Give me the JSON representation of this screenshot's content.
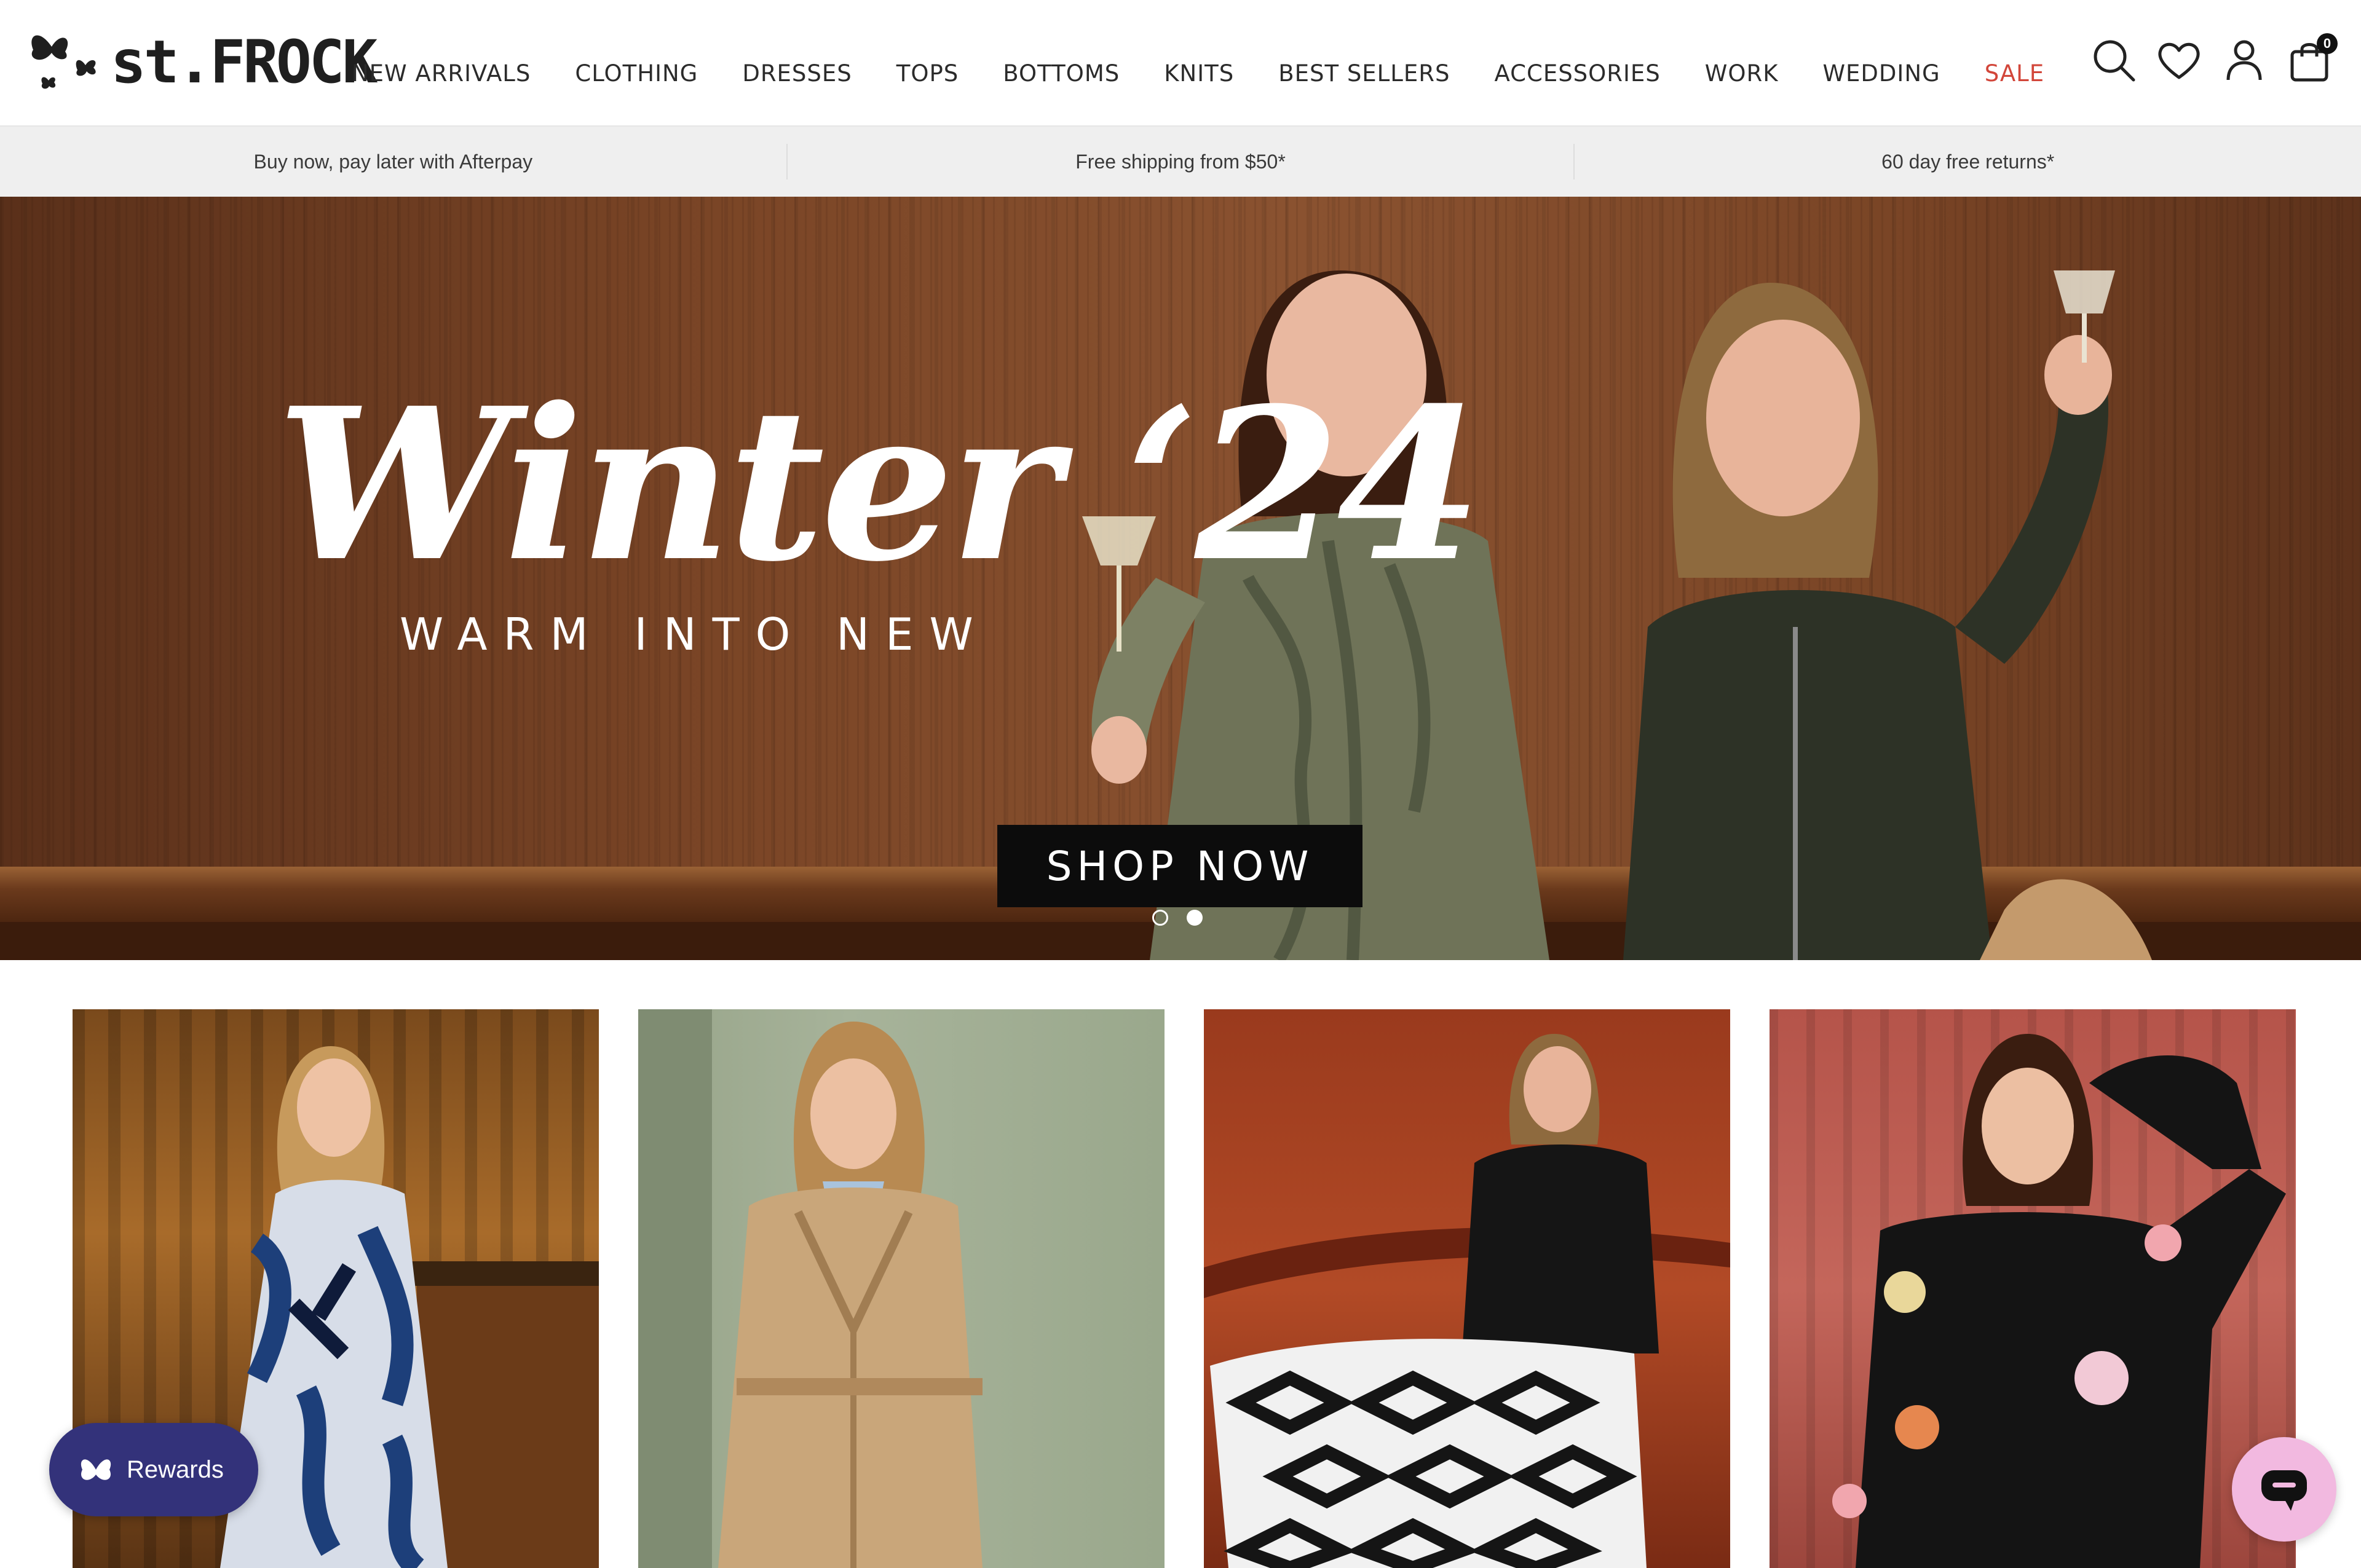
{
  "header": {
    "logo_text": "st.FROCK",
    "nav": [
      {
        "label": "NEW ARRIVALS"
      },
      {
        "label": "CLOTHING"
      },
      {
        "label": "DRESSES"
      },
      {
        "label": "TOPS"
      },
      {
        "label": "BOTTOMS"
      },
      {
        "label": "KNITS"
      },
      {
        "label": "BEST SELLERS"
      },
      {
        "label": "ACCESSORIES"
      },
      {
        "label": "WORK"
      },
      {
        "label": "WEDDING"
      },
      {
        "label": "SALE"
      }
    ],
    "icons": [
      "search-icon",
      "wishlist-heart-icon",
      "account-icon",
      "cart-bag-icon"
    ],
    "cart_count": "0",
    "sale_color": "#d2463a"
  },
  "announcement": {
    "items": [
      {
        "text": "Buy now, pay later with Afterpay"
      },
      {
        "text": "Free shipping from $50*"
      },
      {
        "text": "60 day free returns*"
      }
    ]
  },
  "hero": {
    "title": "Winter ‘24",
    "subtitle": "WARM INTO NEW",
    "cta_label": "SHOP NOW",
    "slides_total": 2,
    "active_slide": 2
  },
  "tiles": [
    {
      "name": "tile-printed-dress"
    },
    {
      "name": "tile-trench-coat"
    },
    {
      "name": "tile-geometric-skirt"
    },
    {
      "name": "tile-floral-cardigan"
    }
  ],
  "widgets": {
    "rewards_label": "Rewards",
    "rewards_color": "#33327a",
    "chat_color": "#f2b9e0"
  }
}
